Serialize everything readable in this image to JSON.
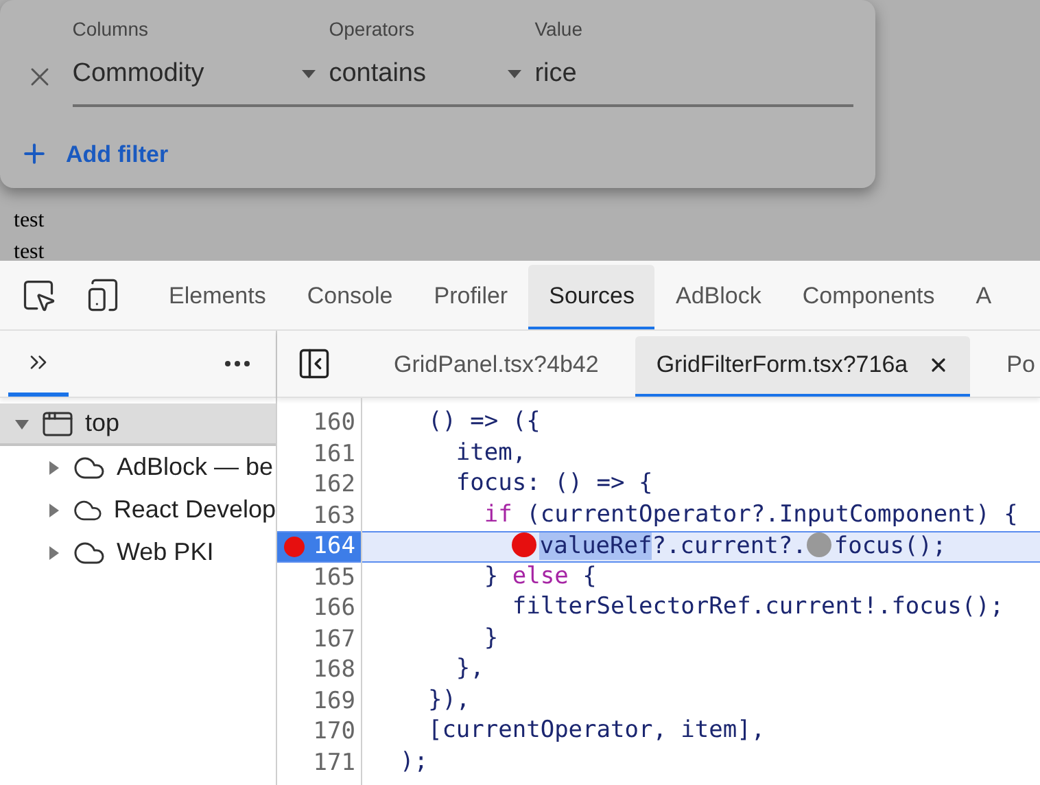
{
  "page": {
    "filter_panel": {
      "filters": [
        {
          "columns_label": "Columns",
          "column": "Commodity",
          "operators_label": "Operators",
          "operator": "contains",
          "value_label": "Value",
          "value": "rice"
        }
      ],
      "add_filter": "Add filter"
    },
    "body_lines": [
      "test",
      "test"
    ]
  },
  "devtools": {
    "tabs": [
      {
        "label": "Elements",
        "selected": false
      },
      {
        "label": "Console",
        "selected": false
      },
      {
        "label": "Profiler",
        "selected": false
      },
      {
        "label": "Sources",
        "selected": true
      },
      {
        "label": "AdBlock",
        "selected": false
      },
      {
        "label": "Components",
        "selected": false
      },
      {
        "label": "A",
        "selected": false
      }
    ],
    "navigator_tabs": [
      {
        "selected": true
      }
    ],
    "tree": [
      {
        "label": "top",
        "kind": "frame",
        "expanded": true,
        "selected": true,
        "children": [
          {
            "label": "AdBlock — be",
            "kind": "cloud",
            "expanded": false,
            "selected": false
          },
          {
            "label": "React Develop",
            "kind": "cloud",
            "expanded": false,
            "selected": false
          },
          {
            "label": "Web PKI",
            "kind": "cloud",
            "expanded": false,
            "selected": false
          }
        ]
      }
    ],
    "editor_tabs": [
      {
        "label": "GridPanel.tsx?4b42",
        "selected": false,
        "closable": false
      },
      {
        "label": "GridFilterForm.tsx?716a",
        "selected": true,
        "closable": true
      },
      {
        "label": "Po",
        "selected": false,
        "closable": false
      }
    ],
    "code_lines": [
      {
        "number": "160",
        "breakpoint": false,
        "segments": [
          {
            "kind": "plain",
            "text": "    () => ({"
          }
        ]
      },
      {
        "number": "161",
        "breakpoint": false,
        "segments": [
          {
            "kind": "plain",
            "text": "      item,"
          }
        ]
      },
      {
        "number": "162",
        "breakpoint": false,
        "segments": [
          {
            "kind": "plain",
            "text": "      focus: () => {"
          }
        ]
      },
      {
        "number": "163",
        "breakpoint": false,
        "segments": [
          {
            "kind": "keyword",
            "text": "        if"
          },
          {
            "kind": "plain",
            "text": " (currentOperator?.InputComponent) {"
          }
        ]
      },
      {
        "number": "164",
        "breakpoint": true,
        "segments": [
          {
            "kind": "selection",
            "text": "          valueRef",
            "marker": true,
            "marker_active": true
          },
          {
            "kind": "plain",
            "text": "?.current?."
          },
          {
            "kind": "plain",
            "text": "focus();",
            "marker": true,
            "marker_active": false
          }
        ]
      },
      {
        "number": "165",
        "breakpoint": false,
        "segments": [
          {
            "kind": "plain",
            "text": "        } "
          },
          {
            "kind": "keyword",
            "text": "else"
          },
          {
            "kind": "plain",
            "text": " {"
          }
        ]
      },
      {
        "number": "166",
        "breakpoint": false,
        "segments": [
          {
            "kind": "plain",
            "text": "          filterSelectorRef.current!.focus();"
          }
        ]
      },
      {
        "number": "167",
        "breakpoint": false,
        "segments": [
          {
            "kind": "plain",
            "text": "        }"
          }
        ]
      },
      {
        "number": "168",
        "breakpoint": false,
        "segments": [
          {
            "kind": "plain",
            "text": "      },"
          }
        ]
      },
      {
        "number": "169",
        "breakpoint": false,
        "segments": [
          {
            "kind": "plain",
            "text": "    }),"
          }
        ]
      },
      {
        "number": "170",
        "breakpoint": false,
        "segments": [
          {
            "kind": "plain",
            "text": "    [currentOperator, item],"
          }
        ]
      },
      {
        "number": "171",
        "breakpoint": false,
        "segments": [
          {
            "kind": "plain",
            "text": "  );"
          }
        ]
      }
    ]
  }
}
